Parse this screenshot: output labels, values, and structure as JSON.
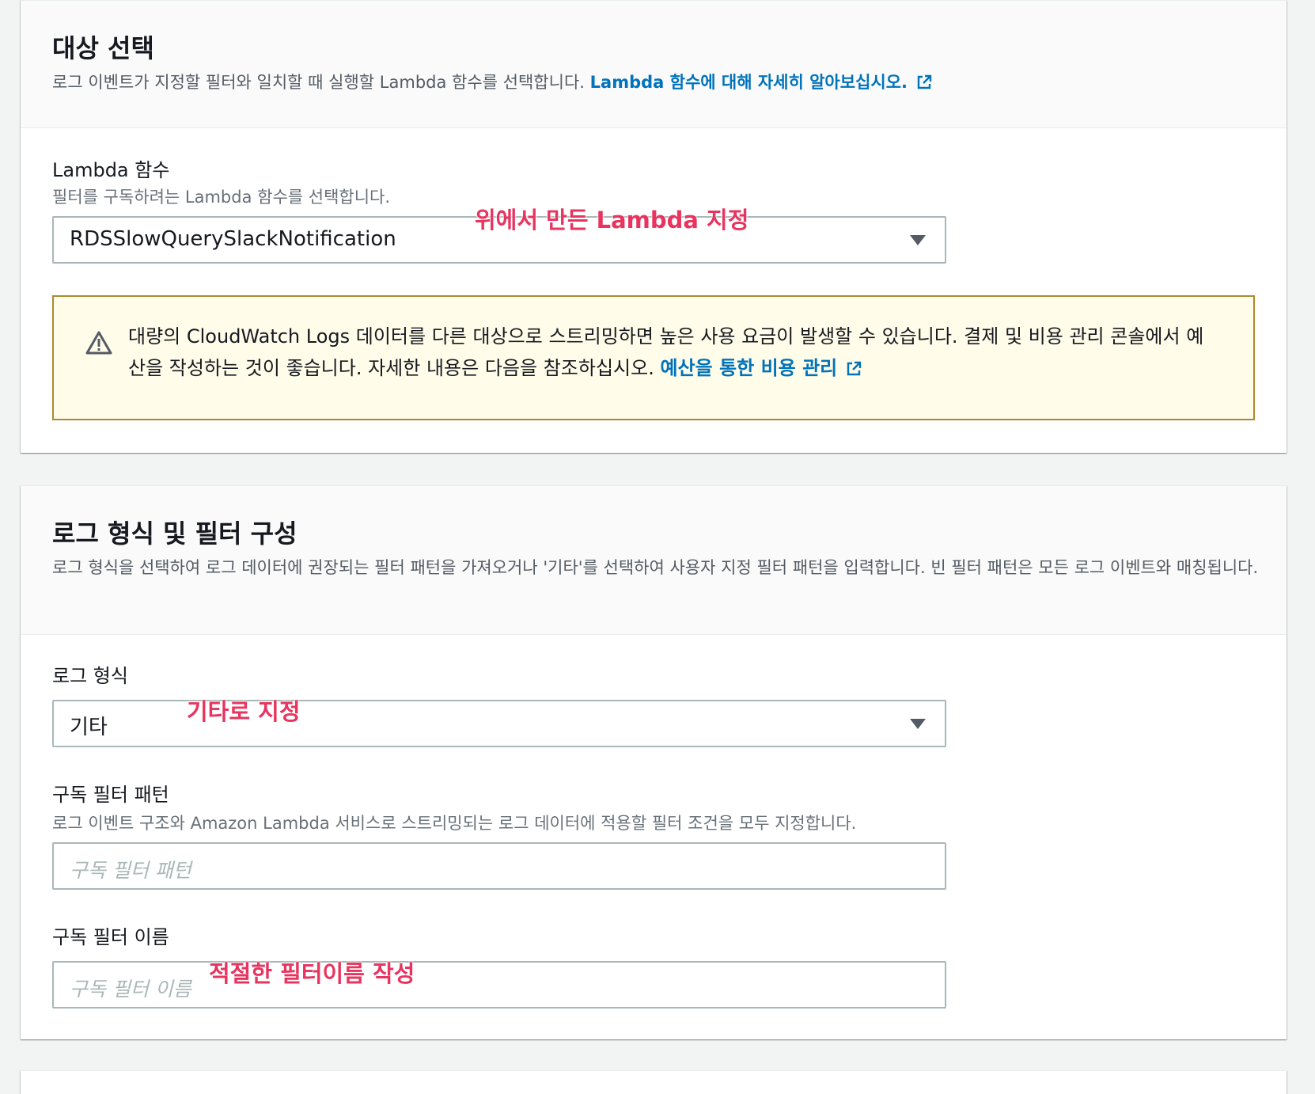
{
  "target_panel": {
    "title": "대상 선택",
    "description": "로그 이벤트가 지정할 필터와 일치할 때 실행할 Lambda 함수를 선택합니다.",
    "learn_more_link": "Lambda 함수에 대해 자세히 알아보십시오.",
    "lambda_field": {
      "label": "Lambda 함수",
      "description": "필터를 구독하려는 Lambda 함수를 선택합니다.",
      "selected_value": "RDSSlowQuerySlackNotification"
    },
    "annotation": "위에서 만든 Lambda 지정",
    "warning": {
      "text": "대량의 CloudWatch Logs 데이터를 다른 대상으로 스트리밍하면 높은 사용 요금이 발생할 수 있습니다. 결제 및 비용 관리 콘솔에서 예산을 작성하는 것이 좋습니다. 자세한 내용은 다음을 참조하십시오.",
      "link": "예산을 통한 비용 관리"
    }
  },
  "filter_panel": {
    "title": "로그 형식 및 필터 구성",
    "description": "로그 형식을 선택하여 로그 데이터에 권장되는 필터 패턴을 가져오거나 '기타'를 선택하여 사용자 지정 필터 패턴을 입력합니다. 빈 필터 패턴은 모든 로그 이벤트와 매칭됩니다.",
    "log_format": {
      "label": "로그 형식",
      "selected_value": "기타",
      "annotation": "기타로 지정"
    },
    "filter_pattern": {
      "label": "구독 필터 패턴",
      "description": "로그 이벤트 구조와 Amazon Lambda 서비스로 스트리밍되는 로그 데이터에 적용할 필터 조건을 모두 지정합니다.",
      "placeholder": "구독 필터 패턴"
    },
    "filter_name": {
      "label": "구독 필터 이름",
      "placeholder": "구독 필터 이름",
      "annotation": "적절한 필터이름 작성"
    }
  },
  "colors": {
    "link": "#0073bb",
    "annotation": "#e8345f",
    "warning_border": "#ae8a2f",
    "warning_bg": "#fffce9"
  }
}
